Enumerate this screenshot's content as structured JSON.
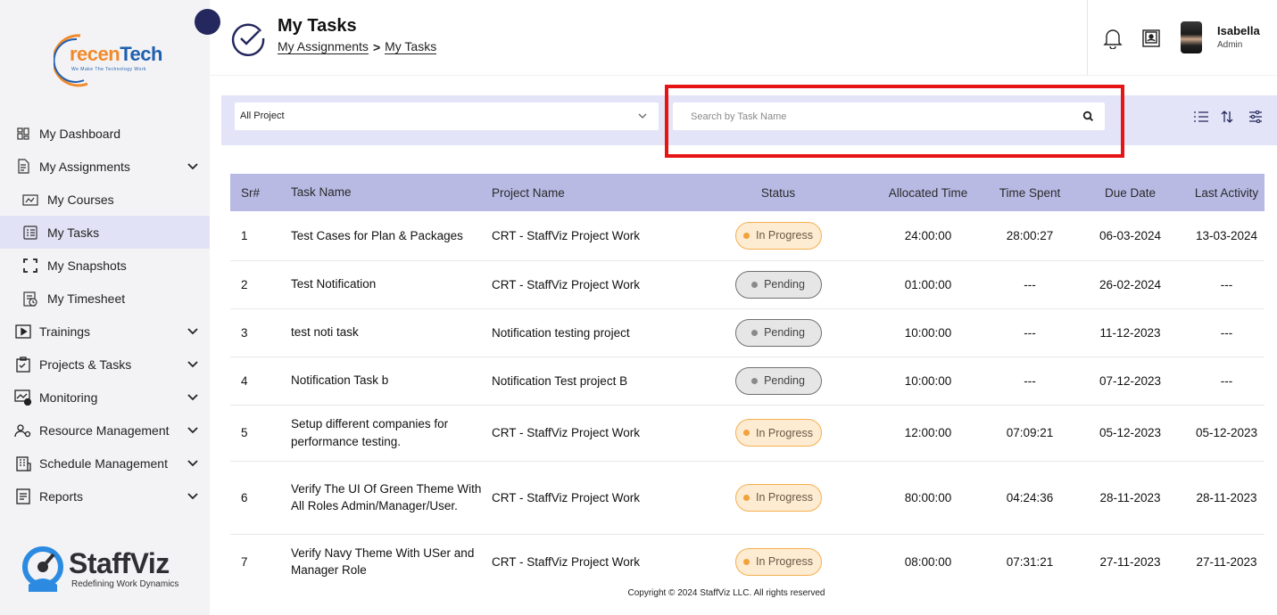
{
  "sidebar": {
    "logo": {
      "text_a": "recen",
      "text_b": "Tech",
      "tagline": "We Make The Technology Work"
    },
    "items": [
      {
        "label": "My Dashboard",
        "icon": "dashboard-icon"
      },
      {
        "label": "My Assignments",
        "icon": "assignments-icon",
        "expandable": true
      },
      {
        "label": "My Courses",
        "icon": "courses-icon",
        "sub": true
      },
      {
        "label": "My Tasks",
        "icon": "tasks-icon",
        "sub": true,
        "active": true
      },
      {
        "label": "My Snapshots",
        "icon": "snapshot-icon",
        "sub": true
      },
      {
        "label": "My Timesheet",
        "icon": "timesheet-icon",
        "sub": true
      },
      {
        "label": "Trainings",
        "icon": "play-icon",
        "expandable": true
      },
      {
        "label": "Projects & Tasks",
        "icon": "clipboard-icon",
        "expandable": true
      },
      {
        "label": "Monitoring",
        "icon": "monitoring-icon",
        "expandable": true
      },
      {
        "label": "Resource Management",
        "icon": "users-gear-icon",
        "expandable": true
      },
      {
        "label": "Schedule Management",
        "icon": "building-icon",
        "expandable": true
      },
      {
        "label": "Reports",
        "icon": "report-icon",
        "expandable": true
      }
    ],
    "brand": {
      "name": "StaffViz",
      "tagline": "Redefining Work Dynamics"
    }
  },
  "header": {
    "title": "My Tasks",
    "breadcrumb": {
      "parent": "My Assignments",
      "separator": ">",
      "current": "My Tasks"
    },
    "user": {
      "name": "Isabella",
      "role": "Admin"
    }
  },
  "filters": {
    "project_select": "All Project",
    "search_placeholder": "Search by Task Name"
  },
  "table": {
    "columns": [
      "Sr#",
      "Task Name",
      "Project Name",
      "Status",
      "Allocated Time",
      "Time Spent",
      "Due Date",
      "Last Activity"
    ],
    "rows": [
      {
        "sr": "1",
        "task": "Test Cases for Plan & Packages",
        "project": "CRT - StaffViz Project Work",
        "status": "In Progress",
        "allocated": "24:00:00",
        "spent": "28:00:27",
        "due": "06-03-2024",
        "last": "13-03-2024"
      },
      {
        "sr": "2",
        "task": "Test Notification",
        "project": "CRT - StaffViz Project Work",
        "status": "Pending",
        "allocated": "01:00:00",
        "spent": "---",
        "due": "26-02-2024",
        "last": "---"
      },
      {
        "sr": "3",
        "task": "test noti task",
        "project": "Notification testing project",
        "status": "Pending",
        "allocated": "10:00:00",
        "spent": "---",
        "due": "11-12-2023",
        "last": "---"
      },
      {
        "sr": "4",
        "task": "Notification Task b",
        "project": "Notification Test project B",
        "status": "Pending",
        "allocated": "10:00:00",
        "spent": "---",
        "due": "07-12-2023",
        "last": "---"
      },
      {
        "sr": "5",
        "task": "Setup different companies for performance testing.",
        "project": "CRT - StaffViz Project Work",
        "status": "In Progress",
        "allocated": "12:00:00",
        "spent": "07:09:21",
        "due": "05-12-2023",
        "last": "05-12-2023"
      },
      {
        "sr": "6",
        "task": "Verify The UI Of Green Theme With All Roles Admin/Manager/User.",
        "project": "CRT - StaffViz Project Work",
        "status": "In Progress",
        "allocated": "80:00:00",
        "spent": "04:24:36",
        "due": "28-11-2023",
        "last": "28-11-2023"
      },
      {
        "sr": "7",
        "task": "Verify Navy Theme With USer and Manager Role",
        "project": "CRT - StaffViz Project Work",
        "status": "In Progress",
        "allocated": "08:00:00",
        "spent": "07:31:21",
        "due": "27-11-2023",
        "last": "27-11-2023"
      }
    ]
  },
  "footer": {
    "text": "Copyright © 2024 StaffViz LLC. All rights reserved"
  },
  "colors": {
    "sidebar_bg": "#f3f3f5",
    "active_item": "#e2e2f6",
    "filter_bar": "#e3e4f7",
    "table_header": "#b8bae4",
    "in_progress": "#f2a23a",
    "pending": "#8a8a8a",
    "highlight": "#e51515",
    "navy": "#24285e"
  }
}
